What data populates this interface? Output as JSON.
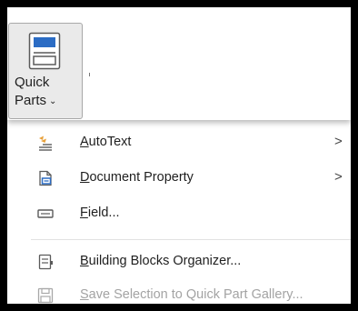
{
  "ribbon": {
    "quick_parts": {
      "line1": "Quick",
      "line2": "Parts",
      "chevron": "⌄"
    }
  },
  "menu": {
    "items": [
      {
        "mnemonic": "A",
        "rest": "utoText",
        "icon": "autotext-icon",
        "submenu": ">",
        "enabled": true
      },
      {
        "mnemonic": "D",
        "rest": "ocument Property",
        "icon": "document-property-icon",
        "submenu": ">",
        "enabled": true
      },
      {
        "mnemonic": "F",
        "rest": "ield...",
        "icon": "field-icon",
        "submenu": "",
        "enabled": true
      },
      {
        "mnemonic": "B",
        "rest": "uilding Blocks Organizer...",
        "icon": "building-blocks-icon",
        "submenu": "",
        "enabled": true
      },
      {
        "mnemonic": "S",
        "rest": "ave Selection to Quick Part Gallery...",
        "icon": "save-selection-icon",
        "submenu": "",
        "enabled": false
      }
    ]
  },
  "colors": {
    "accent_blue": "#2b6cc4",
    "icon_gray": "#5a5a5a",
    "disabled_text": "#a3a3a3",
    "autotext_orange": "#e8a13a"
  }
}
